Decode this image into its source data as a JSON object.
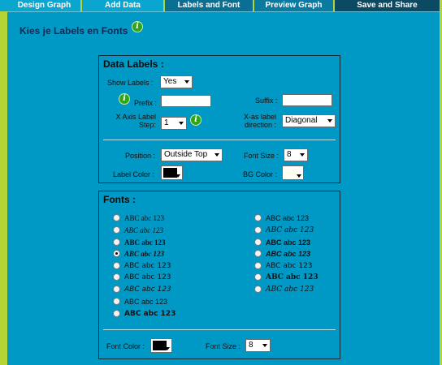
{
  "tabs": [
    {
      "label": "Design Graph"
    },
    {
      "label": "Add Data"
    },
    {
      "label": "Labels and Font"
    },
    {
      "label": "Preview Graph"
    },
    {
      "label": "Save and Share"
    }
  ],
  "page_title": "Kies je Labels en Fonts",
  "info_glyph": "i",
  "colors": {
    "accent_green": "#b6d433",
    "panel_blue": "#0098c4",
    "active_tab": "#0b6f93"
  },
  "data_labels": {
    "title": "Data Labels :",
    "show_labels_label": "Show Labels :",
    "show_labels_value": "Yes",
    "prefix_label": "Prefix :",
    "prefix_value": "",
    "suffix_label": "Suffix :",
    "suffix_value": "",
    "x_axis_step_label_line1": "X Axis Label",
    "x_axis_step_label_line2": "Step:",
    "x_axis_step_value": "1",
    "x_label_direction_line1": "X-as label",
    "x_label_direction_line2": "direction :",
    "x_label_direction_value": "Diagonal",
    "position_label": "Position :",
    "position_value": "Outside Top",
    "font_size_label": "Font Size :",
    "font_size_value": "8",
    "label_color_label": "Label Color :",
    "label_color_value": "#000000",
    "bg_color_label": "BG Color :",
    "bg_color_value": "#fdfdf0"
  },
  "fonts": {
    "title": "Fonts :",
    "options_left": [
      {
        "text": "ABC abc 123",
        "checked": false
      },
      {
        "text": "ABC abc 123",
        "checked": false
      },
      {
        "text": "ABC abc 123",
        "checked": false
      },
      {
        "text": "ABC abc 123",
        "checked": true
      },
      {
        "text": "ABC abc 123",
        "checked": false
      },
      {
        "text": "ABC abc 123",
        "checked": false
      },
      {
        "text": "ABC abc 123",
        "checked": false
      },
      {
        "text": "ABC abc 123",
        "checked": false
      },
      {
        "text": "ABC abc 123",
        "checked": false
      }
    ],
    "options_right": [
      {
        "text": "ABC abc 123",
        "checked": false
      },
      {
        "text": "ABC abc 123",
        "checked": false
      },
      {
        "text": "ABC abc 123",
        "checked": false
      },
      {
        "text": "ABC abc 123",
        "checked": false
      },
      {
        "text": "ABC abc 123",
        "checked": false
      },
      {
        "text": "ABC abc 123",
        "checked": false
      },
      {
        "text": "ABC abc 123",
        "checked": false
      }
    ],
    "font_color_label": "Font Color :",
    "font_color_value": "#000000",
    "font_size_label": "Font Size :",
    "font_size_value": "8"
  }
}
